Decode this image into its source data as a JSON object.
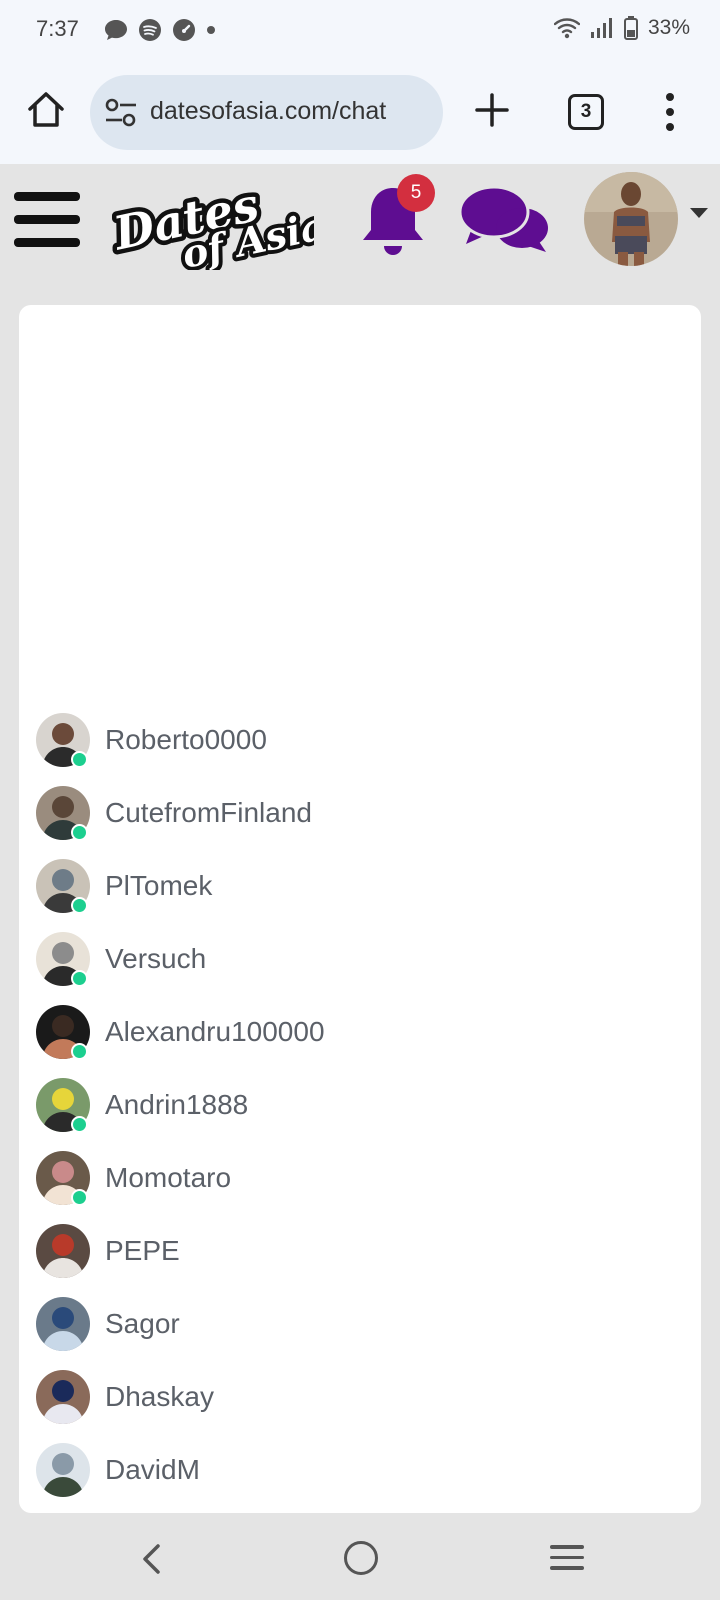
{
  "status_bar": {
    "time": "7:37",
    "battery": "33%"
  },
  "browser": {
    "url": "datesofasia.com/chat",
    "tab_count": "3"
  },
  "header": {
    "logo_text": "Dates of Asia",
    "notification_count": "5"
  },
  "users": [
    {
      "name": "Roberto0000",
      "online": true
    },
    {
      "name": "CutefromFinland",
      "online": true
    },
    {
      "name": "PlTomek",
      "online": true
    },
    {
      "name": "Versuch",
      "online": true
    },
    {
      "name": "Alexandru100000",
      "online": true
    },
    {
      "name": "Andrin1888",
      "online": true
    },
    {
      "name": "Momotaro",
      "online": true
    },
    {
      "name": "PEPE",
      "online": false
    },
    {
      "name": "Sagor",
      "online": false
    },
    {
      "name": "Dhaskay",
      "online": false
    },
    {
      "name": "DavidM",
      "online": false
    },
    {
      "name": "",
      "online": false
    }
  ],
  "colors": {
    "brand_purple": "#5e0d91",
    "online_green": "#1ccf8f",
    "badge_red": "#d32f3f"
  }
}
